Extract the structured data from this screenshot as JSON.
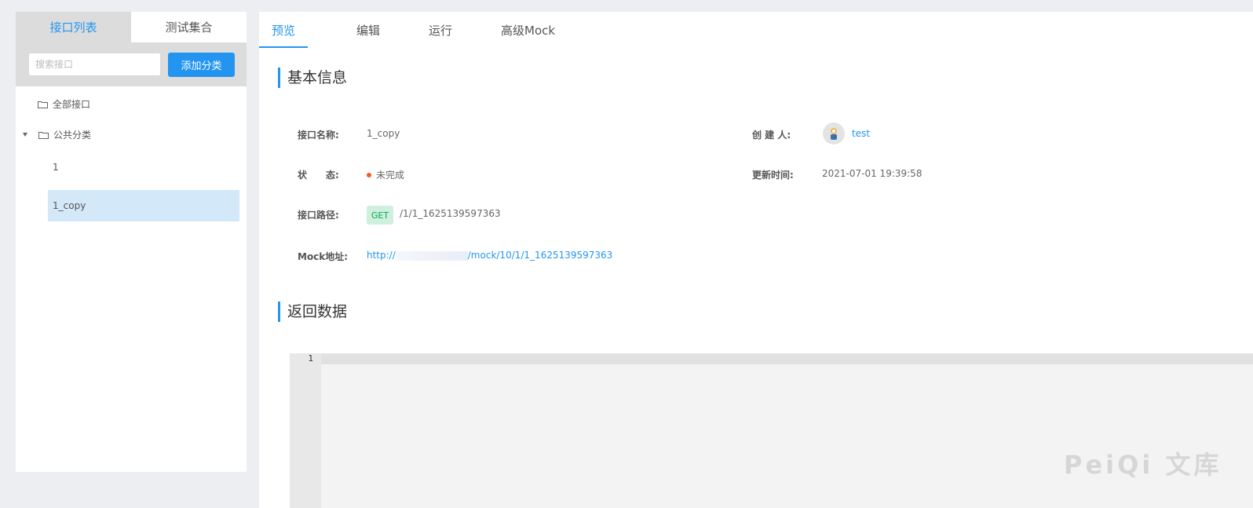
{
  "left_tabs": {
    "api_list": "接口列表",
    "test_collection": "测试集合"
  },
  "search": {
    "placeholder": "搜索接口"
  },
  "add_category_label": "添加分类",
  "tree": {
    "all_apis": "全部接口",
    "public_category": "公共分类",
    "items": [
      "1",
      "1_copy"
    ]
  },
  "top_tabs": [
    "预览",
    "编辑",
    "运行",
    "高级Mock"
  ],
  "sections": {
    "basic_info": "基本信息",
    "response_data": "返回数据"
  },
  "fields": {
    "name_label": "接口名称:",
    "name_value": "1_copy",
    "creator_label": "创 建 人:",
    "creator_value": "test",
    "status_label": "状　　态:",
    "status_value": "未完成",
    "updated_label": "更新时间:",
    "updated_value": "2021-07-01 19:39:58",
    "path_label": "接口路径:",
    "method": "GET",
    "path_value": "/1/1_1625139597363",
    "mock_label": "Mock地址:",
    "mock_prefix": "http://",
    "mock_suffix": "/mock/10/1/1_1625139597363"
  },
  "editor": {
    "line_number": "1"
  },
  "watermark": "PeiQi 文库",
  "colors": {
    "accent": "#2395f1",
    "status_dot": "#f25a27",
    "get_badge_bg": "#cfefdf",
    "get_badge_text": "#00a854"
  }
}
